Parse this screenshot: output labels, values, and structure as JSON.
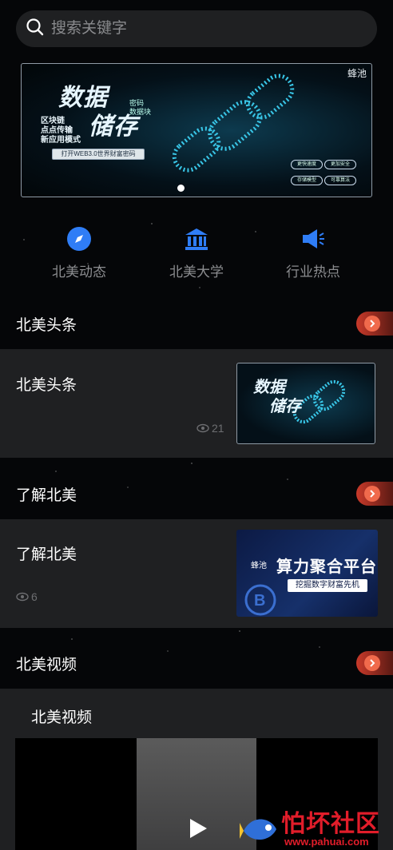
{
  "search": {
    "placeholder": "搜索关键字"
  },
  "banner": {
    "brand": "蜂池",
    "title_line1": "数据",
    "title_line2": "储存",
    "sub_right": [
      "密码",
      "数据块"
    ],
    "lines": [
      "区块链",
      "点点传输",
      "新应用模式"
    ],
    "cta": "打开WEB3.0世界财富密码",
    "tags": [
      "更快速度",
      "更加安全",
      "存储模型",
      "可靠算法"
    ]
  },
  "nav": [
    {
      "label": "北美动态",
      "icon": "compass-icon"
    },
    {
      "label": "北美大学",
      "icon": "university-icon"
    },
    {
      "label": "行业热点",
      "icon": "megaphone-icon"
    }
  ],
  "sections": [
    {
      "title": "北美头条",
      "card_title": "北美头条",
      "views": "21"
    },
    {
      "title": "了解北美",
      "card_title": "了解北美",
      "views": "6",
      "thumb_brand": "蜂池",
      "thumb_title": "算力聚合平台",
      "thumb_sub": "挖掘数字财富先机"
    },
    {
      "title": "北美视频",
      "card_title": "北美视频"
    }
  ],
  "watermark": {
    "text": "怕坏社区",
    "url": "www.pahuai.com"
  },
  "colors": {
    "accent": "#f06a4c",
    "bg": "#050608",
    "card": "#222325"
  }
}
